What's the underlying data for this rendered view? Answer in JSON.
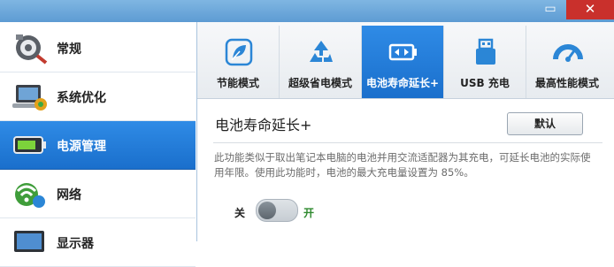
{
  "window": {
    "close_glyph": "✕",
    "maximize_glyph": "▭"
  },
  "sidebar": {
    "items": [
      {
        "label": "常规",
        "icon": "gear-icon"
      },
      {
        "label": "系统优化",
        "icon": "laptop-icon"
      },
      {
        "label": "电源管理",
        "icon": "battery-icon",
        "active": true
      },
      {
        "label": "网络",
        "icon": "wifi-globe-icon"
      },
      {
        "label": "显示器",
        "icon": "monitor-icon"
      }
    ]
  },
  "tabs": [
    {
      "label": "节能模式",
      "icon": "leaf-icon"
    },
    {
      "label": "超级省电模式",
      "icon": "recycle-icon"
    },
    {
      "label": "电池寿命延长+",
      "icon": "battery-cycle-icon",
      "active": true
    },
    {
      "label": "USB 充电",
      "icon": "usb-icon"
    },
    {
      "label": "最高性能模式",
      "icon": "speedometer-icon"
    }
  ],
  "content": {
    "title": "电池寿命延长+",
    "default_button": "默认",
    "description": "此功能类似于取出笔记本电脑的电池并用交流适配器为其充电，可延长电池的实际使用年限。使用此功能时，电池的最大充电量设置为 85%。",
    "toggle": {
      "off_label": "关",
      "on_label": "开",
      "state": "off"
    }
  },
  "colors": {
    "accent": "#1f7fe0",
    "on_label": "#2f8a2f"
  }
}
